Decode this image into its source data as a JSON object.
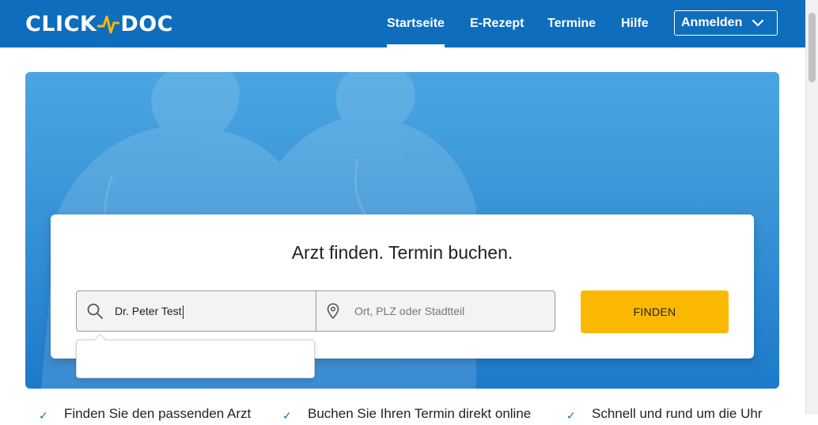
{
  "header": {
    "logo_left": "CLICK",
    "logo_right": "DOC",
    "nav": [
      {
        "label": "Startseite",
        "active": true
      },
      {
        "label": "E-Rezept",
        "active": false
      },
      {
        "label": "Termine",
        "active": false
      },
      {
        "label": "Hilfe",
        "active": false
      }
    ],
    "login_label": "Anmelden"
  },
  "hero": {
    "title": "Arzt finden. Termin buchen.",
    "name_value": "Dr. Peter Test",
    "location_placeholder": "Ort, PLZ oder Stadtteil",
    "find_label": "FINDEN"
  },
  "benefits": [
    "Finden Sie den passenden Arzt",
    "Buchen Sie Ihren Termin direkt online",
    "Schnell und rund um die Uhr"
  ],
  "colors": {
    "brand_blue": "#0e6dbd",
    "accent_yellow": "#fbb800",
    "logo_pulse": "#fbb800"
  },
  "icons": {
    "search": "search-icon",
    "location": "location-pin-icon",
    "chevron": "chevron-down-icon"
  }
}
